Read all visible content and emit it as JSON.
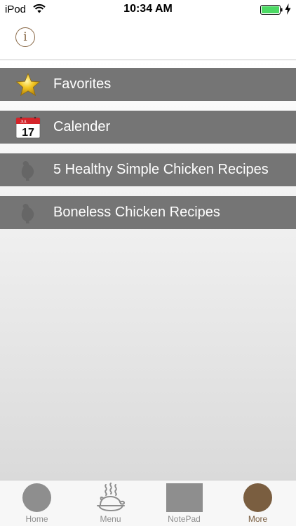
{
  "status_bar": {
    "carrier": "iPod",
    "time": "10:34 AM",
    "battery_color": "#4cd964"
  },
  "nav_bar": {
    "info_label": "i",
    "accent_color": "#8a6a48"
  },
  "menu": {
    "items": [
      {
        "label": "Favorites",
        "icon": "star-icon"
      },
      {
        "label": "Calender",
        "icon": "calendar-icon",
        "calendar_day": "17",
        "calendar_month": "JUL"
      },
      {
        "label": "5 Healthy Simple Chicken Recipes",
        "icon": "chicken-icon"
      },
      {
        "label": "Boneless Chicken Recipes",
        "icon": "chicken-icon"
      }
    ]
  },
  "tab_bar": {
    "tabs": [
      {
        "label": "Home",
        "icon": "home-circle-icon",
        "active": false
      },
      {
        "label": "Menu",
        "icon": "food-dish-icon",
        "active": false
      },
      {
        "label": "NotePad",
        "icon": "notepad-square-icon",
        "active": false
      },
      {
        "label": "More",
        "icon": "more-circle-icon",
        "active": true
      }
    ],
    "active_color": "#7a5e40",
    "inactive_icon_color": "#8e8e8e"
  }
}
